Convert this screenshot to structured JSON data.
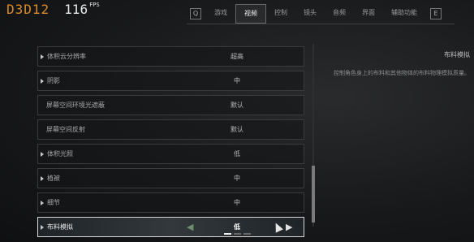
{
  "hud": {
    "code": "D3D12",
    "fps_value": "116",
    "fps_unit": "FPS"
  },
  "nav": {
    "left_key": "Q",
    "right_key": "E",
    "tabs": [
      {
        "label": "游戏",
        "active": false
      },
      {
        "label": "视频",
        "active": true
      },
      {
        "label": "控制",
        "active": false
      },
      {
        "label": "镜头",
        "active": false
      },
      {
        "label": "音频",
        "active": false
      },
      {
        "label": "界面",
        "active": false
      },
      {
        "label": "辅助功能",
        "active": false
      }
    ]
  },
  "settings": [
    {
      "label": "体积云分辨率",
      "value": "超高",
      "expandable": true,
      "sub": false
    },
    {
      "label": "阴影",
      "value": "中",
      "expandable": true,
      "sub": false
    },
    {
      "label": "屏幕空间环境光遮蔽",
      "value": "默认",
      "expandable": false,
      "sub": true
    },
    {
      "label": "屏幕空间反射",
      "value": "默认",
      "expandable": false,
      "sub": true
    },
    {
      "label": "体积光照",
      "value": "低",
      "expandable": true,
      "sub": false
    },
    {
      "label": "植被",
      "value": "中",
      "expandable": true,
      "sub": false
    },
    {
      "label": "细节",
      "value": "中",
      "expandable": true,
      "sub": false
    },
    {
      "label": "布料模拟",
      "value": "低",
      "expandable": true,
      "sub": false,
      "selected": true,
      "level_of": 3,
      "level": 1
    }
  ],
  "description": {
    "title": "布料模拟",
    "text": "控制角色身上的布料和其他物体的布料物理模拟质量。"
  },
  "colors": {
    "accent_code": "#d98c2e",
    "selected_border": "#d9d9d9"
  }
}
